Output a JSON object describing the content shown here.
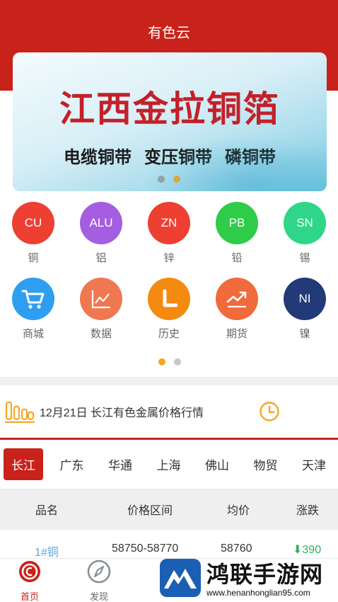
{
  "app": {
    "title": "有色云",
    "accent_color": "#c9221a"
  },
  "banner": {
    "title": "江西金拉铜箔",
    "subtitles": [
      "电缆铜带",
      "变压铜带",
      "磷铜带"
    ],
    "active_dot": 1
  },
  "metals": [
    {
      "code": "CU",
      "label": "铜",
      "color": "#ee3f33"
    },
    {
      "code": "ALU",
      "label": "铝",
      "color": "#a55ee0"
    },
    {
      "code": "ZN",
      "label": "锌",
      "color": "#ee3f33"
    },
    {
      "code": "PB",
      "label": "铅",
      "color": "#2ecc49"
    },
    {
      "code": "SN",
      "label": "锡",
      "color": "#2fd68a"
    }
  ],
  "features": [
    {
      "icon": "cart-icon",
      "label": "商城",
      "color": "#2f9ef0"
    },
    {
      "icon": "line-chart-icon",
      "label": "数据",
      "color": "#f07850"
    },
    {
      "icon": "clock-l-icon",
      "label": "历史",
      "color": "#f58a10"
    },
    {
      "icon": "trend-up-icon",
      "label": "期货",
      "color": "#f06a3c"
    },
    {
      "code": "NI",
      "label": "镍",
      "color": "#233a78"
    }
  ],
  "news": {
    "text": "12月21日 长江有色金属价格行情"
  },
  "tabs": [
    "长江",
    "广东",
    "华通",
    "上海",
    "佛山",
    "物贸",
    "天津"
  ],
  "table": {
    "headers": [
      "品名",
      "价格区间",
      "均价",
      "涨跌"
    ],
    "rows": [
      {
        "name": "1#铜",
        "range": "58750-58770",
        "avg": "58760",
        "change": "390"
      }
    ]
  },
  "nav": [
    {
      "label": "首页",
      "icon": "home-logo-icon"
    },
    {
      "label": "发现",
      "icon": "compass-icon"
    }
  ],
  "watermark": {
    "title": "鸿联手游网",
    "url": "www.henanhonglian95.com"
  }
}
